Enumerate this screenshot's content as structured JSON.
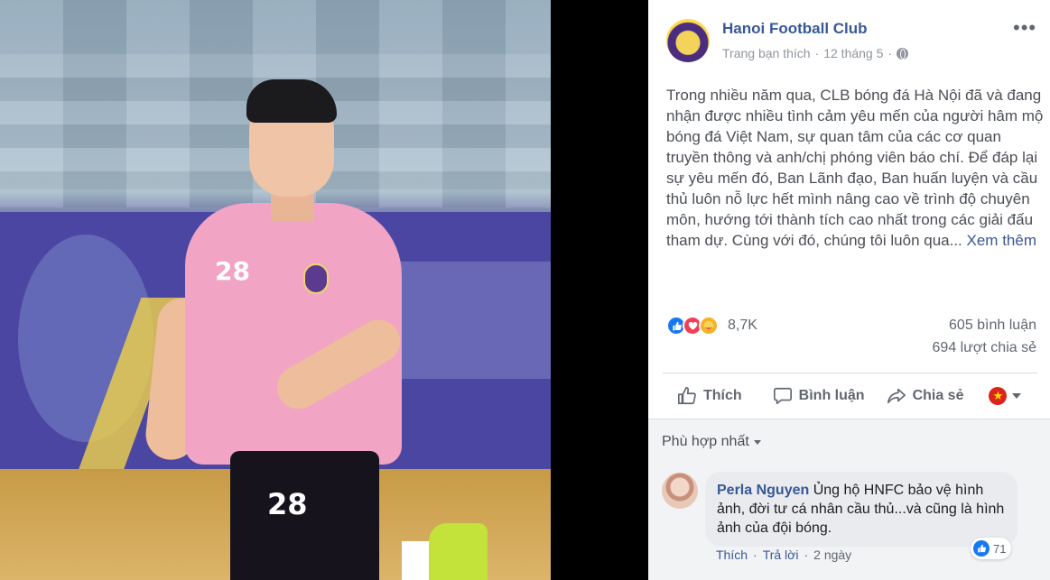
{
  "post": {
    "page_name": "Hanoi Football Club",
    "meta_label": "Trang bạn thích",
    "date": "12 tháng 5",
    "separator": "·",
    "more_glyph": "•••",
    "body": "Trong nhiều năm qua, CLB bóng đá Hà Nội đã và đang nhận được nhiều tình cảm yêu mến của người hâm mộ bóng đá Việt Nam, sự quan tâm của các cơ quan truyền thông và anh/chị phóng viên báo chí. Để đáp lại sự yêu mến đó, Ban Lãnh đạo, Ban huấn luyện và cầu thủ luôn nỗ lực hết mình nâng cao về trình độ chuyên môn, hướng tới thành tích cao nhất trong các giải đấu tham dự. Cùng với đó, chúng tôi luôn qua...",
    "see_more": "Xem thêm"
  },
  "photo": {
    "jersey_number": "28"
  },
  "stats": {
    "reaction_count": "8,7K",
    "comments": "605 bình luận",
    "shares": "694 lượt chia sẻ"
  },
  "actions": {
    "like": "Thích",
    "comment": "Bình luận",
    "share": "Chia sẻ"
  },
  "comments": {
    "sort_label": "Phù hợp nhất",
    "items": [
      {
        "author": "Perla Nguyen",
        "text": "Ủng hộ HNFC bảo vệ hình ảnh, đời tư cá nhân cầu thủ...và cũng là hình ảnh của đội bóng.",
        "like_label": "Thích",
        "reply_label": "Trả lời",
        "time": "2 ngày",
        "reaction_count": "71"
      }
    ]
  },
  "colors": {
    "link": "#385898",
    "like_blue": "#1877f2",
    "vn_flag_red": "#da251d"
  }
}
